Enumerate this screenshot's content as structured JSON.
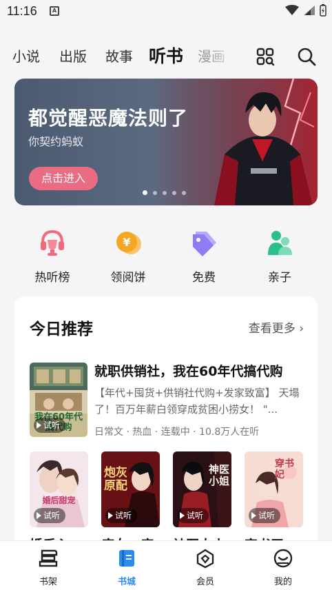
{
  "status_bar": {
    "time": "11:16",
    "notif_letter": "A"
  },
  "top_nav": {
    "tabs": [
      {
        "label": "小说"
      },
      {
        "label": "出版"
      },
      {
        "label": "故事"
      },
      {
        "label": "听书"
      },
      {
        "label": "漫画"
      }
    ],
    "active_tab": "听书"
  },
  "banner": {
    "title": "都觉醒恶魔法则了",
    "subtitle": "你契约蚂蚁",
    "button": "点击进入",
    "page_count": 5,
    "active_page": 1
  },
  "quick_entries": [
    {
      "label": "热听榜",
      "icon": "headphone-trophy-icon",
      "color": "#f26b7a"
    },
    {
      "label": "领阅饼",
      "icon": "coin-icon",
      "color": "#f5a623"
    },
    {
      "label": "免费",
      "icon": "tag-icon",
      "color": "#8e7cf2"
    },
    {
      "label": "亲子",
      "icon": "parent-child-icon",
      "color": "#2bbf8a"
    }
  ],
  "recommend": {
    "title": "今日推荐",
    "more": "查看更多 ›",
    "featured": {
      "title": "就职供销社，我在60年代搞代购",
      "desc": "【年代+囤货+供销社代购+发家致富】 天塌了！百万年薪白领穿成贫困小捞女！ \"...",
      "meta": "日常文 · 热血 · 连载中 · 10.8万人在听",
      "cover_text": "我在60年代搞代购"
    },
    "try_label": "试听",
    "books": [
      {
        "title": "婚后心",
        "cover_text": "婚后甜宠"
      },
      {
        "title": "庶女：庶",
        "cover_text": "炮灰原配"
      },
      {
        "title": "神医大小",
        "cover_text": "神医小姐"
      },
      {
        "title": "穿书王",
        "cover_text": "穿书妃"
      }
    ]
  },
  "bottom_tabs": [
    {
      "label": "书架",
      "icon": "bookshelf-icon"
    },
    {
      "label": "书城",
      "icon": "bookstore-icon"
    },
    {
      "label": "会员",
      "icon": "vip-icon"
    },
    {
      "label": "我的",
      "icon": "profile-icon"
    }
  ],
  "active_bottom_tab": "书城",
  "colors": {
    "accent": "#2a8cf0",
    "banner_button": "#ea6c83"
  }
}
